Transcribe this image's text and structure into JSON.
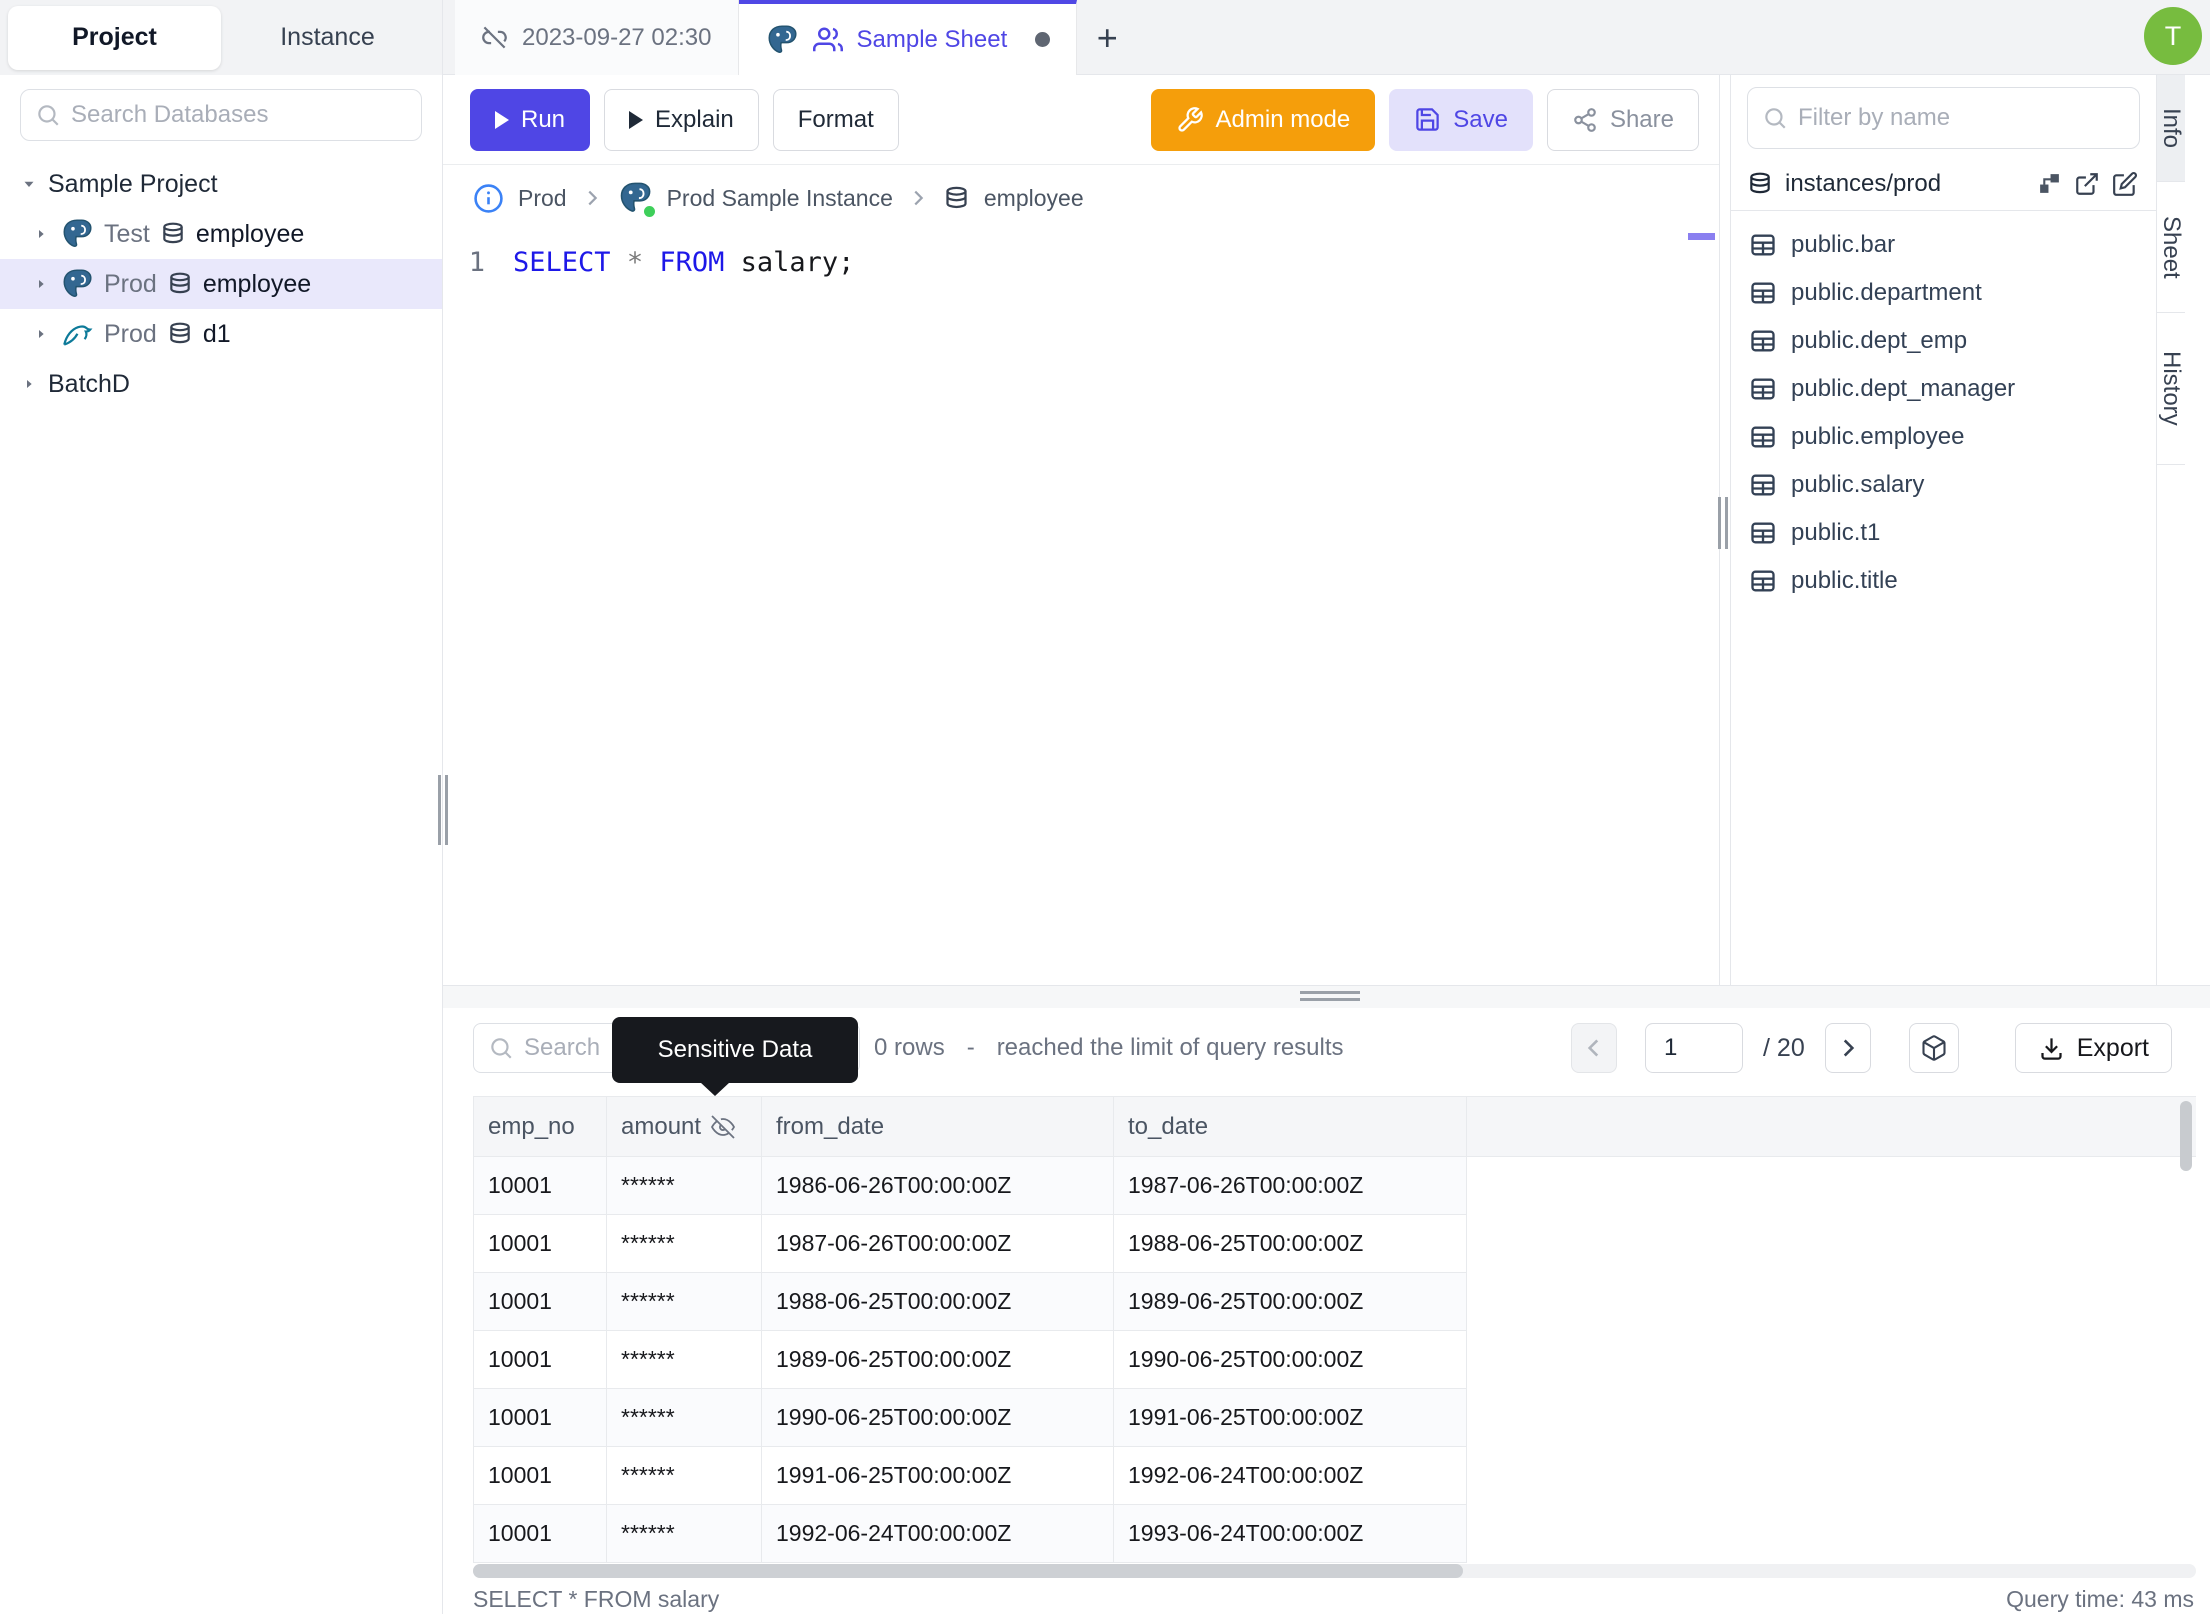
{
  "app": {
    "avatar_initial": "T"
  },
  "colors": {
    "accent": "#4f46e5",
    "admin_orange": "#f59e0b",
    "avatar_green": "#77bc3f",
    "sql_keyword_blue": "#1d18e8",
    "selected_tree_row": "#e9e8fb",
    "tooltip_bg": "#17191e"
  },
  "sidebar": {
    "tabs": {
      "project": "Project",
      "instance": "Instance"
    },
    "search_placeholder": "Search Databases",
    "project_group": "Sample Project",
    "databases": [
      {
        "env": "Test",
        "engine": "postgresql",
        "name": "employee"
      },
      {
        "env": "Prod",
        "engine": "postgresql",
        "name": "employee"
      },
      {
        "env": "Prod",
        "engine": "mysql",
        "name": "d1"
      }
    ],
    "batch_group": "BatchD"
  },
  "sheet_tabs": {
    "tab1": "2023-09-27 02:30",
    "tab2": "Sample Sheet",
    "new_tab": "+"
  },
  "toolbar": {
    "run": "Run",
    "explain": "Explain",
    "format": "Format",
    "admin_mode": "Admin mode",
    "save": "Save",
    "share": "Share"
  },
  "breadcrumb": {
    "environment": "Prod",
    "instance": "Prod Sample Instance",
    "database": "employee"
  },
  "editor": {
    "line_number": "1",
    "sql_select": "SELECT",
    "sql_star": "*",
    "sql_from": "FROM",
    "sql_rest": "salary;"
  },
  "schema_panel": {
    "filter_placeholder": "Filter by name",
    "header": "instances/prod",
    "tables": [
      "public.bar",
      "public.department",
      "public.dept_emp",
      "public.dept_manager",
      "public.employee",
      "public.salary",
      "public.t1",
      "public.title"
    ]
  },
  "side_strip": {
    "info": "Info",
    "sheet": "Sheet",
    "history": "History"
  },
  "results": {
    "search_placeholder": "Search",
    "tooltip": "Sensitive Data",
    "row_count": "0 rows",
    "dash": "-",
    "limit_message": "reached the limit of query results",
    "page": "1",
    "page_total": "/ 20",
    "export": "Export",
    "columns": [
      "emp_no",
      "amount",
      "from_date",
      "to_date"
    ],
    "rows": [
      [
        "10001",
        "******",
        "1986-06-26T00:00:00Z",
        "1987-06-26T00:00:00Z"
      ],
      [
        "10001",
        "******",
        "1987-06-26T00:00:00Z",
        "1988-06-25T00:00:00Z"
      ],
      [
        "10001",
        "******",
        "1988-06-25T00:00:00Z",
        "1989-06-25T00:00:00Z"
      ],
      [
        "10001",
        "******",
        "1989-06-25T00:00:00Z",
        "1990-06-25T00:00:00Z"
      ],
      [
        "10001",
        "******",
        "1990-06-25T00:00:00Z",
        "1991-06-25T00:00:00Z"
      ],
      [
        "10001",
        "******",
        "1991-06-25T00:00:00Z",
        "1992-06-24T00:00:00Z"
      ],
      [
        "10001",
        "******",
        "1992-06-24T00:00:00Z",
        "1993-06-24T00:00:00Z"
      ]
    ],
    "status_query": "SELECT * FROM salary",
    "query_time": "Query time: 43 ms"
  }
}
